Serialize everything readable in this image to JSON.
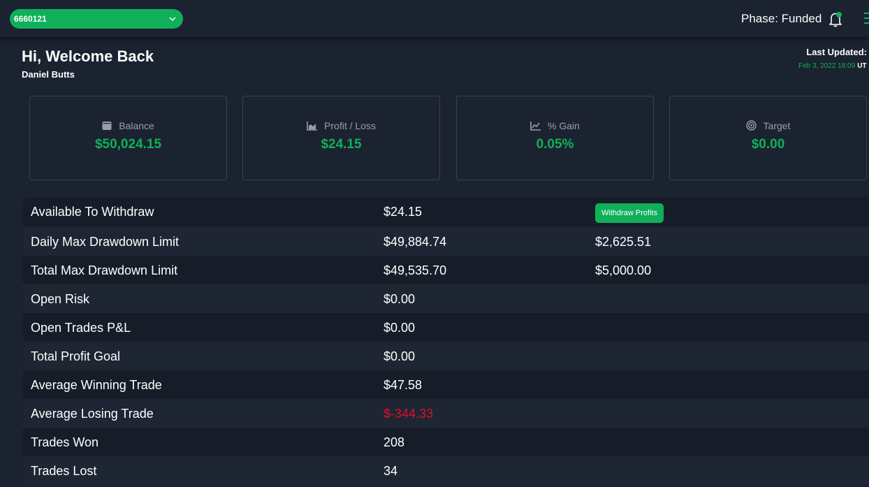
{
  "topbar": {
    "account_id": "6660121",
    "phase": "Phase: Funded"
  },
  "header": {
    "greeting": "Hi, Welcome Back",
    "user_name": "Daniel Butts",
    "last_updated_label": "Last Updated:",
    "last_updated_value": "Feb 3, 2022 18:09",
    "last_updated_tz": "UT"
  },
  "cards": [
    {
      "label": "Balance",
      "value": "$50,024.15",
      "icon": "wallet-icon"
    },
    {
      "label": "Profit / Loss",
      "value": "$24.15",
      "icon": "bar-chart-icon"
    },
    {
      "label": "% Gain",
      "value": "0.05%",
      "icon": "line-chart-icon"
    },
    {
      "label": "Target",
      "value": "$0.00",
      "icon": "target-icon"
    }
  ],
  "table": {
    "withdraw_button": "Withdraw Profits",
    "rows": [
      {
        "label": "Available To Withdraw",
        "value": "$24.15",
        "extra": ""
      },
      {
        "label": "Daily Max Drawdown Limit",
        "value": "$49,884.74",
        "extra": "$2,625.51"
      },
      {
        "label": "Total Max Drawdown Limit",
        "value": "$49,535.70",
        "extra": "$5,000.00"
      },
      {
        "label": "Open Risk",
        "value": "$0.00",
        "extra": ""
      },
      {
        "label": "Open Trades P&L",
        "value": "$0.00",
        "extra": ""
      },
      {
        "label": "Total Profit Goal",
        "value": "$0.00",
        "extra": ""
      },
      {
        "label": "Average Winning Trade",
        "value": "$47.58",
        "extra": ""
      },
      {
        "label": "Average Losing Trade",
        "value": "$-344.33",
        "extra": ""
      },
      {
        "label": "Trades Won",
        "value": "208",
        "extra": ""
      },
      {
        "label": "Trades Lost",
        "value": "34",
        "extra": ""
      }
    ]
  },
  "colors": {
    "accent": "#10b05a",
    "negative": "#e0102a",
    "background": "#1b2230"
  }
}
